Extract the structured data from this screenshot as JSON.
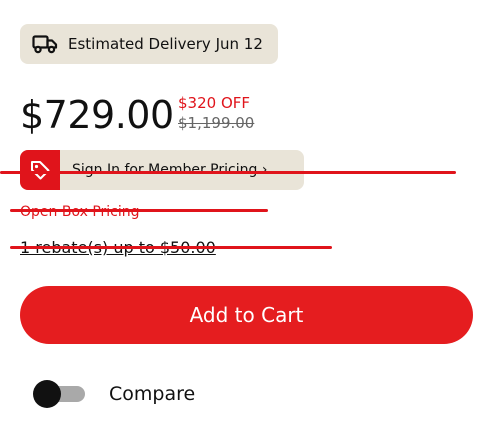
{
  "delivery": {
    "icon": "truck-icon",
    "label": "Estimated Delivery Jun 12"
  },
  "pricing": {
    "price": "$729.00",
    "discount": "$320 OFF",
    "original_price": "$1,199.00"
  },
  "member": {
    "icon": "tag-icon",
    "label": "Sign In for Member Pricing ›"
  },
  "open_box": {
    "label": "Open Box Pricing"
  },
  "rebate": {
    "label": "1 rebate(s) up to $50.00"
  },
  "cart": {
    "add_label": "Add to Cart"
  },
  "compare": {
    "label": "Compare",
    "enabled": false
  },
  "colors": {
    "accent": "#e51d1f",
    "pill_bg": "#e9e4d8",
    "annotation_strike": "#e0141b"
  }
}
